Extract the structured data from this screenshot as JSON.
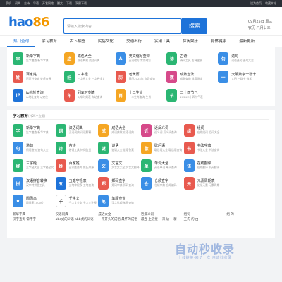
{
  "topbar": {
    "nav": [
      "手机",
      "词典",
      "古诗",
      "导语",
      "开发网络",
      "翻文",
      "下载",
      "洞察下载"
    ],
    "right": [
      "设为首页",
      "收藏本站"
    ]
  },
  "logo": {
    "part1": "hao",
    "part2": "86"
  },
  "search": {
    "placeholder": "请输入搜索内容",
    "button": "搜索"
  },
  "date": {
    "line1": "09月25日 周三",
    "line2": "农历 八月廿三"
  },
  "tabs": [
    "热门查询",
    "学习教育",
    "古卜抽签",
    "民俗文化",
    "交通出行",
    "实用工具",
    "休闲娱乐",
    "身体健康",
    "最新更新"
  ],
  "hot": [
    {
      "t1": "新华字典",
      "t2": "生字速查 新华字典",
      "color": "#2bb673",
      "g": "字"
    },
    {
      "t1": "成语大全",
      "t2": "成语典故 成语词典",
      "color": "#f5a623",
      "g": "成"
    },
    {
      "t1": "英文缩写查询",
      "t2": "英语缩写 常用缩写",
      "color": "#3a8ee6",
      "g": "A"
    },
    {
      "t1": "古诗",
      "t2": "诗词工具 古诗鉴赏",
      "color": "#2bb673",
      "g": "诗"
    },
    {
      "t1": "造句",
      "t2": "词语造句 造句大全",
      "color": "#3a8ee6",
      "g": "句"
    },
    {
      "t1": "百家姓",
      "t2": "百家姓查询 姓氏来源",
      "color": "#e85a4f",
      "g": "姓"
    },
    {
      "t1": "三字经",
      "t2": "三字经大全 三字经全文",
      "color": "#2bb673",
      "g": "经"
    },
    {
      "t1": "老黄历",
      "t2": "黄历2024年 宜忌查询",
      "color": "#e85a4f",
      "g": "历"
    },
    {
      "t1": "成数查法",
      "t2": "成数查询 成语测试",
      "color": "#d64a8a",
      "g": "数"
    },
    {
      "t1": "大明数学一群十",
      "t2": "大明 一群十 数学",
      "color": "#3a8ee6",
      "g": "十"
    },
    {
      "t1": "ip地址查询",
      "t2": "ip地址查询 ip定位",
      "color": "#1e73d9",
      "g": "IP"
    },
    {
      "t1": "列车时刻表",
      "t2": "火车时刻表 车站查询",
      "color": "#e85a4f",
      "g": "车"
    },
    {
      "t1": "十二生肖",
      "t2": "十二生肖查询 生肖",
      "color": "#f5a623",
      "g": "肖"
    },
    {
      "t1": "二十四节气",
      "t2": "2024二十四节气表",
      "color": "#2bb673",
      "g": "节"
    }
  ],
  "study": {
    "title": "学习教育",
    "sub": "(共25个应用)",
    "items": [
      {
        "t1": "新华字典",
        "t2": "生字速查 新华字典",
        "color": "#2bb673",
        "g": "字"
      },
      {
        "t1": "汉语词典",
        "t2": "汉语词典 词语解释",
        "color": "#2bb673",
        "g": "词"
      },
      {
        "t1": "成语大全",
        "t2": "成语典故 成语词典",
        "color": "#f5a623",
        "g": "成"
      },
      {
        "t1": "近反义词",
        "t2": "近义词 反义词查询",
        "color": "#d64a8a",
        "g": "近"
      },
      {
        "t1": "组词",
        "t2": "在线组词 组词大全",
        "color": "#e85a4f",
        "g": "组"
      },
      {
        "t1": "",
        "t2": "",
        "color": "#ffffff",
        "g": ""
      },
      {
        "t1": "造句",
        "t2": "词语造句 造句大全",
        "color": "#3a8ee6",
        "g": "句"
      },
      {
        "t1": "古诗",
        "t2": "诗词工具 诗词鉴赏",
        "color": "#2bb673",
        "g": "诗"
      },
      {
        "t1": "谜语",
        "t2": "谜语大全 谜语答案",
        "color": "#2bb673",
        "g": "谜"
      },
      {
        "t1": "歇后语",
        "t2": "歇后语大全 歇后语查询",
        "color": "#f5a623",
        "g": "歇"
      },
      {
        "t1": "书法字典",
        "t2": "书法大全 书法查询",
        "color": "#e85a4f",
        "g": "书"
      },
      {
        "t1": "",
        "t2": "",
        "color": "#ffffff",
        "g": ""
      },
      {
        "t1": "三字经",
        "t2": "三字经大全 三字经全文",
        "color": "#2bb673",
        "g": "经"
      },
      {
        "t1": "百家姓",
        "t2": "百家姓查询 姓氏来源",
        "color": "#e85a4f",
        "g": "姓"
      },
      {
        "t1": "文言文",
        "t2": "文言文大全 文言文翻译",
        "color": "#3a8ee6",
        "g": "文"
      },
      {
        "t1": "单词大全",
        "t2": "英语单词 单词查询",
        "color": "#2bb673",
        "g": "单"
      },
      {
        "t1": "在线翻译",
        "t2": "在线翻译 中英翻译",
        "color": "#3a8ee6",
        "g": "译"
      },
      {
        "t1": "",
        "t2": "",
        "color": "#ffffff",
        "g": ""
      },
      {
        "t1": "汉语拼音转换",
        "t2": "汉字转拼音工具",
        "color": "#3a8ee6",
        "g": "拼"
      },
      {
        "t1": "五笔字根表",
        "t2": "五笔字根表 五笔查询",
        "color": "#1e73d9",
        "g": "五"
      },
      {
        "t1": "郑码查字",
        "t2": "郑码字典 郑码查询",
        "color": "#e85a4f",
        "g": "郑"
      },
      {
        "t1": "仓颉查字",
        "t2": "仓颉字典 仓颉编码",
        "color": "#3a8ee6",
        "g": "仓"
      },
      {
        "t1": "元素周期表",
        "t2": "化学元素 元素周期",
        "color": "#e85a4f",
        "g": "元"
      },
      {
        "t1": "",
        "t2": "",
        "color": "#ffffff",
        "g": ""
      },
      {
        "t1": "圆周率",
        "t2": "圆周率1000位",
        "color": "#3a8ee6",
        "g": "π"
      },
      {
        "t1": "千字文",
        "t2": "千字文全文 千字文注释",
        "color": "#ffffff",
        "g": "千"
      },
      {
        "t1": "笔顺查询",
        "t2": "汉字笔顺 笔画查询",
        "color": "#3a8ee6",
        "g": "笔"
      }
    ]
  },
  "bottom": [
    [
      "新华字典",
      "汉字查询 常用字"
    ],
    [
      "汉语词典",
      "abc式的词语 abb式的词语"
    ],
    [
      "成语大全",
      "一带开头的成语 最不的成语"
    ],
    [
      "近反义词",
      "最连 上链接 一来 访一 新"
    ],
    [
      "组词",
      "王氏 的 由"
    ],
    [
      "",
      "组 的"
    ]
  ],
  "watermark": {
    "main": "自动秒收录",
    "sub": "上线链接·来访一次·自动秒收录"
  }
}
